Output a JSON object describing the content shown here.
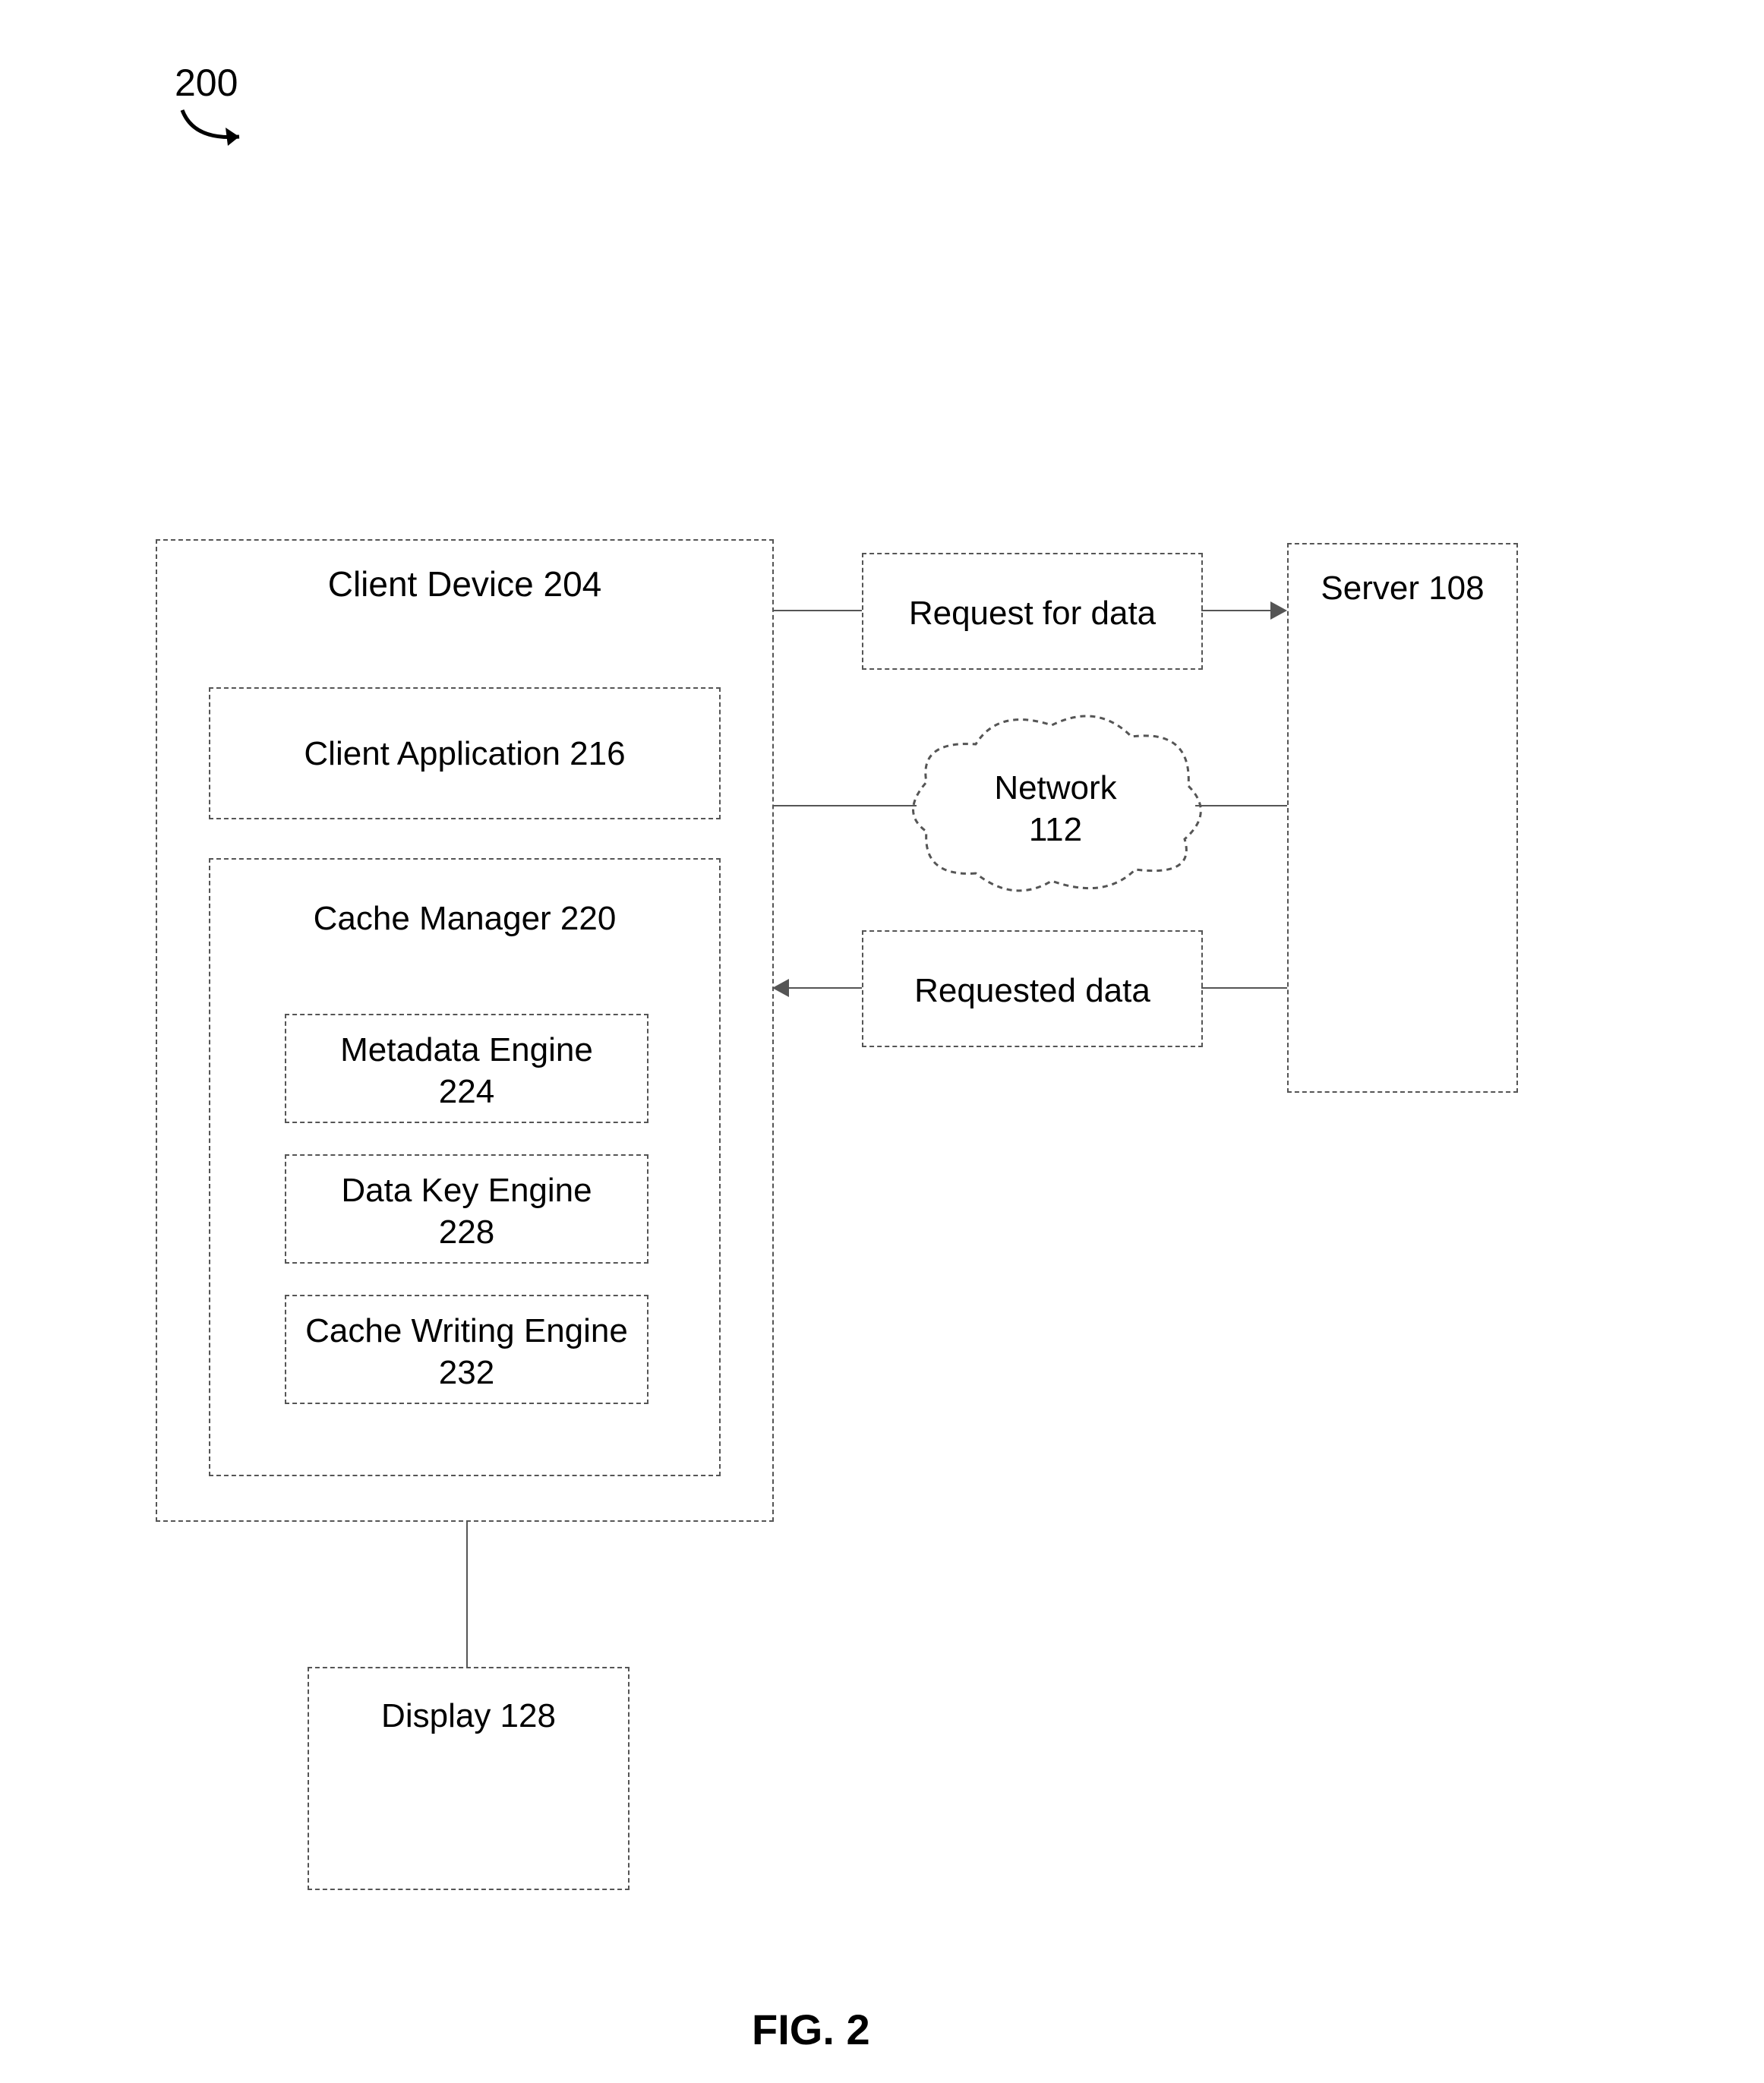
{
  "ref_number": "200",
  "client_device": {
    "title": "Client Device 204"
  },
  "client_application": {
    "title": "Client Application 216"
  },
  "cache_manager": {
    "title": "Cache Manager 220",
    "metadata_engine": "Metadata Engine\n224",
    "data_key_engine": "Data Key Engine\n228",
    "cache_writing_engine": "Cache Writing Engine\n232"
  },
  "request_box": "Request for data",
  "requested_box": "Requested data",
  "network": "Network\n112",
  "server": "Server 108",
  "display": "Display 128",
  "figure_caption": "FIG. 2"
}
